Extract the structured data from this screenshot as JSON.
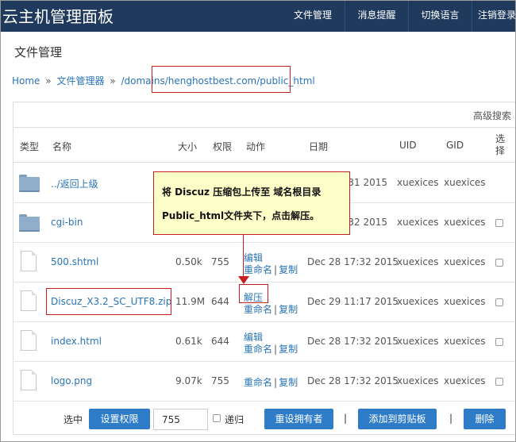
{
  "app": {
    "brand": "云主机管理面板",
    "nav": [
      "文件管理",
      "消息提醒",
      "切换语言",
      "注销登录"
    ]
  },
  "page": {
    "title": "文件管理"
  },
  "breadcrumb": {
    "home": "Home",
    "sep": "»",
    "file_manager": "文件管理器",
    "path": "/domains/henghostbest.com/public_html"
  },
  "toolbar": {
    "advanced_search": "高级搜索"
  },
  "table": {
    "headers": {
      "type": "类型",
      "name": "名称",
      "size": "大小",
      "perm": "权限",
      "action": "动作",
      "date": "日期",
      "uid": "UID",
      "gid": "GID",
      "select": "选择"
    },
    "action_labels": {
      "edit": "编辑",
      "rename": "重命名",
      "copy": "复制",
      "extract": "解压",
      "sep": "|"
    },
    "rows": [
      {
        "type": "folder",
        "name": "../返回上级",
        "size": "",
        "perm": "",
        "date": "Dec 28 17:31 2015",
        "uid": "xuexices",
        "gid": "xuexices"
      },
      {
        "type": "folder",
        "name": "cgi-bin",
        "size": "",
        "perm": "",
        "date": "Dec 28 17:32 2015",
        "uid": "xuexices",
        "gid": "xuexices"
      },
      {
        "type": "file",
        "name": "500.shtml",
        "size": "0.50k",
        "perm": "755",
        "date": "Dec 28 17:32 2015",
        "uid": "xuexices",
        "gid": "xuexices"
      },
      {
        "type": "file",
        "name": "Discuz_X3.2_SC_UTF8.zip",
        "size": "11.9M",
        "perm": "644",
        "date": "Dec 29 11:17 2015",
        "uid": "xuexices",
        "gid": "xuexices"
      },
      {
        "type": "file",
        "name": "index.html",
        "size": "0.61k",
        "perm": "644",
        "date": "Dec 28 17:32 2015",
        "uid": "xuexices",
        "gid": "xuexices"
      },
      {
        "type": "file",
        "name": "logo.png",
        "size": "9.07k",
        "perm": "755",
        "date": "Dec 28 17:32 2015",
        "uid": "xuexices",
        "gid": "xuexices"
      }
    ]
  },
  "tooltip": {
    "line1": "将 Discuz 压缩包上传至 域名根目录",
    "line2": "Public_html文件夹下，点击解压。"
  },
  "footer": {
    "selected_label": "选中",
    "set_perm": "设置权限",
    "perm_value": "755",
    "recursive": "递归",
    "reset_owner": "重设拥有者",
    "add_clipboard": "添加到剪贴板",
    "delete": "删除",
    "sep": "|"
  },
  "colors": {
    "topbar": "#1f3a5c",
    "link": "#2a74b8",
    "button": "#2f7dc8",
    "annotation": "#c81e1e",
    "tooltip_bg": "#fefec8"
  }
}
